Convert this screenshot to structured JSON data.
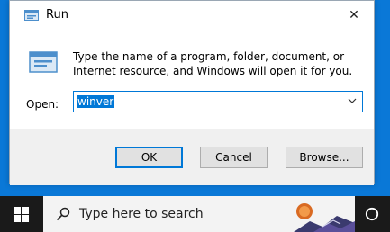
{
  "dialog": {
    "title": "Run",
    "description": "Type the name of a program, folder, document, or Internet resource, and Windows will open it for you.",
    "open_label": "Open:",
    "input_value": "winver",
    "buttons": {
      "ok": "OK",
      "cancel": "Cancel",
      "browse": "Browse..."
    }
  },
  "taskbar": {
    "search_placeholder": "Type here to search"
  },
  "icons": {
    "title": "run-icon",
    "close": "close-icon",
    "large": "run-icon",
    "dropdown": "chevron-down-icon",
    "start": "windows-logo-icon",
    "search": "search-icon",
    "cortana": "cortana-icon"
  },
  "colors": {
    "desktop": "#0a78d7",
    "accent": "#0078d7",
    "taskbar": "#1a1a1a"
  }
}
